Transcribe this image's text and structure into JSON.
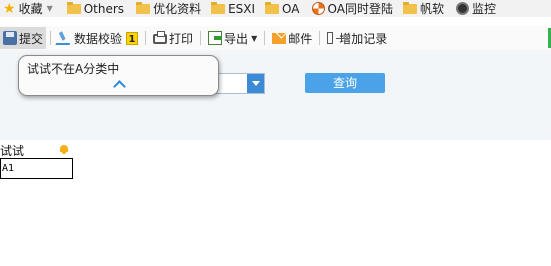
{
  "bookmarks": {
    "favorites_label": "收藏",
    "items": [
      {
        "label": "Others"
      },
      {
        "label": "优化资料"
      },
      {
        "label": "ESXI"
      },
      {
        "label": "OA"
      },
      {
        "label": "OA同时登陆"
      },
      {
        "label": "帆软"
      },
      {
        "label": "监控"
      }
    ]
  },
  "toolbar": {
    "submit_label": "提交",
    "validate_label": "数据校验",
    "validate_badge": "1",
    "print_label": "打印",
    "export_label": "导出",
    "mail_label": "邮件",
    "add_record_label": "增加记录"
  },
  "filter": {
    "query_label": "查询"
  },
  "popup": {
    "message": "试试不在A分类中"
  },
  "field": {
    "label": "试试",
    "value": "A1"
  },
  "colors": {
    "accent_blue": "#4aa3e8",
    "badge_yellow": "#ffd400",
    "folder_yellow": "#f1c14a"
  }
}
